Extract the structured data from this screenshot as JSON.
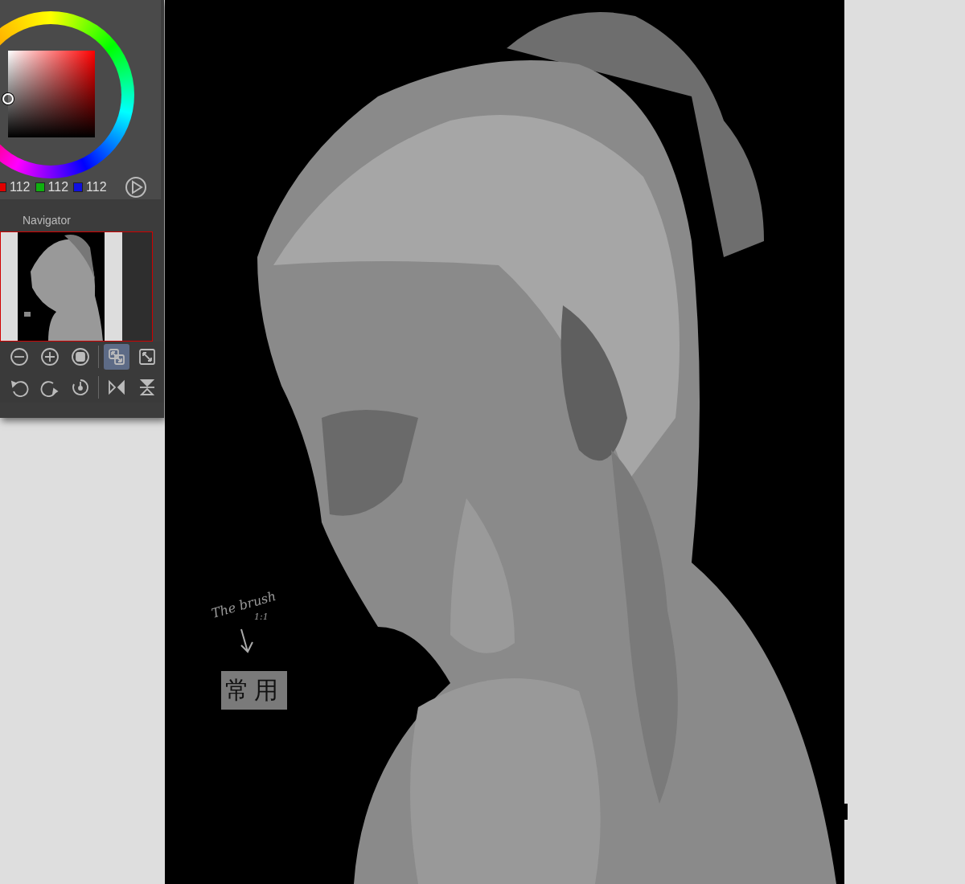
{
  "color_wheel": {
    "channels": [
      {
        "color": "#e00000",
        "value": "112"
      },
      {
        "color": "#10b010",
        "value": "112"
      },
      {
        "color": "#1010e0",
        "value": "112"
      }
    ]
  },
  "navigator": {
    "title": "Navigator",
    "toolbar": [
      [
        {
          "kind": "zoom-out",
          "selected": false
        },
        {
          "kind": "zoom-in",
          "selected": false
        },
        {
          "kind": "fit",
          "selected": false
        },
        {
          "kind": "fit-window",
          "selected": true
        },
        {
          "kind": "full-size",
          "selected": false
        }
      ],
      [
        {
          "kind": "rotate-left",
          "selected": false
        },
        {
          "kind": "rotate-right",
          "selected": false
        },
        {
          "kind": "reset-rotation",
          "selected": false
        },
        {
          "kind": "flip-horizontal",
          "selected": false
        },
        {
          "kind": "flip-vertical",
          "selected": false
        }
      ]
    ]
  },
  "canvas": {
    "notes": [
      {
        "text": "The brush"
      },
      {
        "text": "1:1"
      }
    ],
    "label": "常用"
  }
}
